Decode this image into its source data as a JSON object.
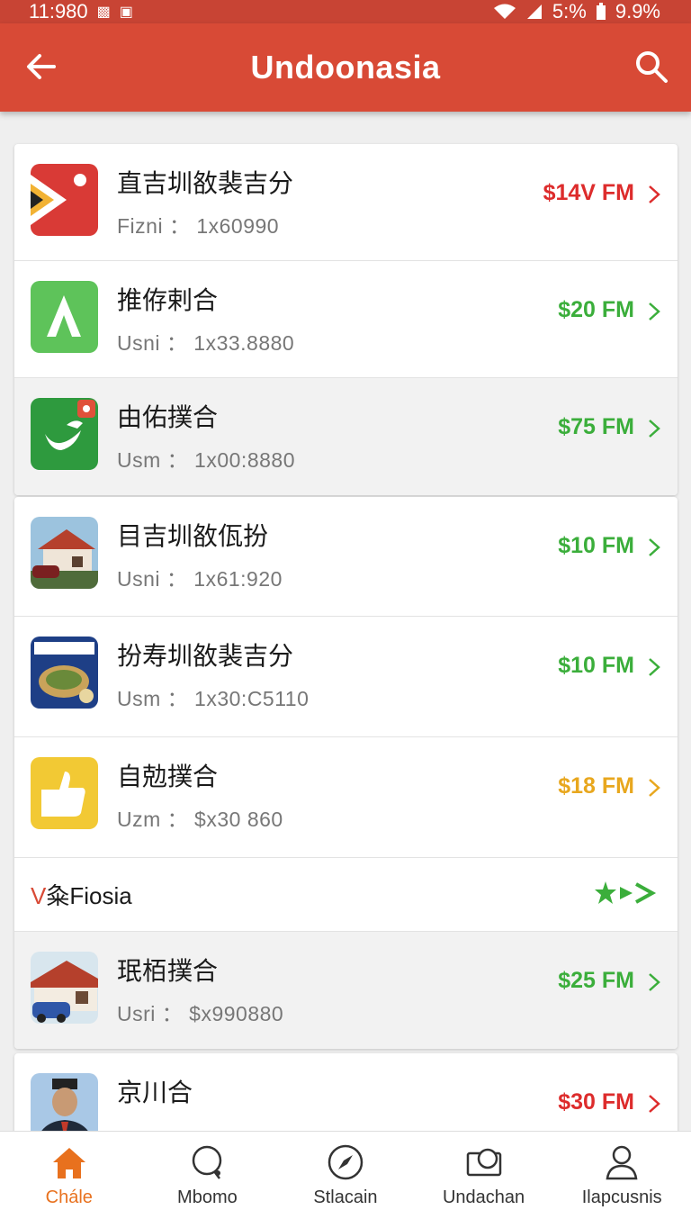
{
  "status_bar": {
    "time": "11:980",
    "network": "5:%",
    "battery": "9.9%"
  },
  "app_bar": {
    "title": "Undoonasia"
  },
  "colors": {
    "brand": "#d84a36",
    "red": "#dd2c2c",
    "green": "#3bae3b",
    "amber": "#e8a71e",
    "nav_active": "#e8711e"
  },
  "items": [
    {
      "title": "直吉圳敋裴吉分",
      "sub": "Fizni ： 1x60990",
      "price": "$14V FM",
      "price_color": "red",
      "thumb": "red-flag-app"
    },
    {
      "title": "推侟剌合",
      "sub": "Usni ： 1x33.8880",
      "price": "$20 FM",
      "price_color": "green",
      "thumb": "green-a-app"
    },
    {
      "title": "由佑撲合",
      "sub": "Usm ： 1x00:8880",
      "price": "$75 FM",
      "price_color": "green",
      "thumb": "green-bird-app"
    },
    {
      "title": "目吉圳敋佤扮",
      "sub": "Usni ： 1x61:920",
      "price": "$10 FM",
      "price_color": "green",
      "thumb": "house-photo"
    },
    {
      "title": "扮寿圳敋裴吉分",
      "sub": "Usm ： 1x30:C5110",
      "price": "$10 FM",
      "price_color": "green",
      "thumb": "food-poster"
    },
    {
      "title": "自勊撲合",
      "sub": "Uzm ： $x30 860",
      "price": "$18 FM",
      "price_color": "amber",
      "thumb": "yellow-thumb-app"
    },
    {
      "title": "珉栢撲合",
      "sub": "Usri ： $x990880",
      "price": "$25 FM",
      "price_color": "green",
      "thumb": "house-car-photo"
    },
    {
      "title": "京川合",
      "sub": "",
      "price": "$30 FM",
      "price_color": "red",
      "thumb": "man-photo"
    }
  ],
  "section": {
    "accent": "V",
    "label": "粂Fiosia"
  },
  "nav": [
    {
      "label": "Chále",
      "icon": "home-icon",
      "active": true
    },
    {
      "label": "Mbomo",
      "icon": "chat-bubble-icon",
      "active": false
    },
    {
      "label": "Stlacain",
      "icon": "compass-icon",
      "active": false
    },
    {
      "label": "Undachan",
      "icon": "camera-icon",
      "active": false
    },
    {
      "label": "Ilapcusnis",
      "icon": "person-icon",
      "active": false
    }
  ]
}
